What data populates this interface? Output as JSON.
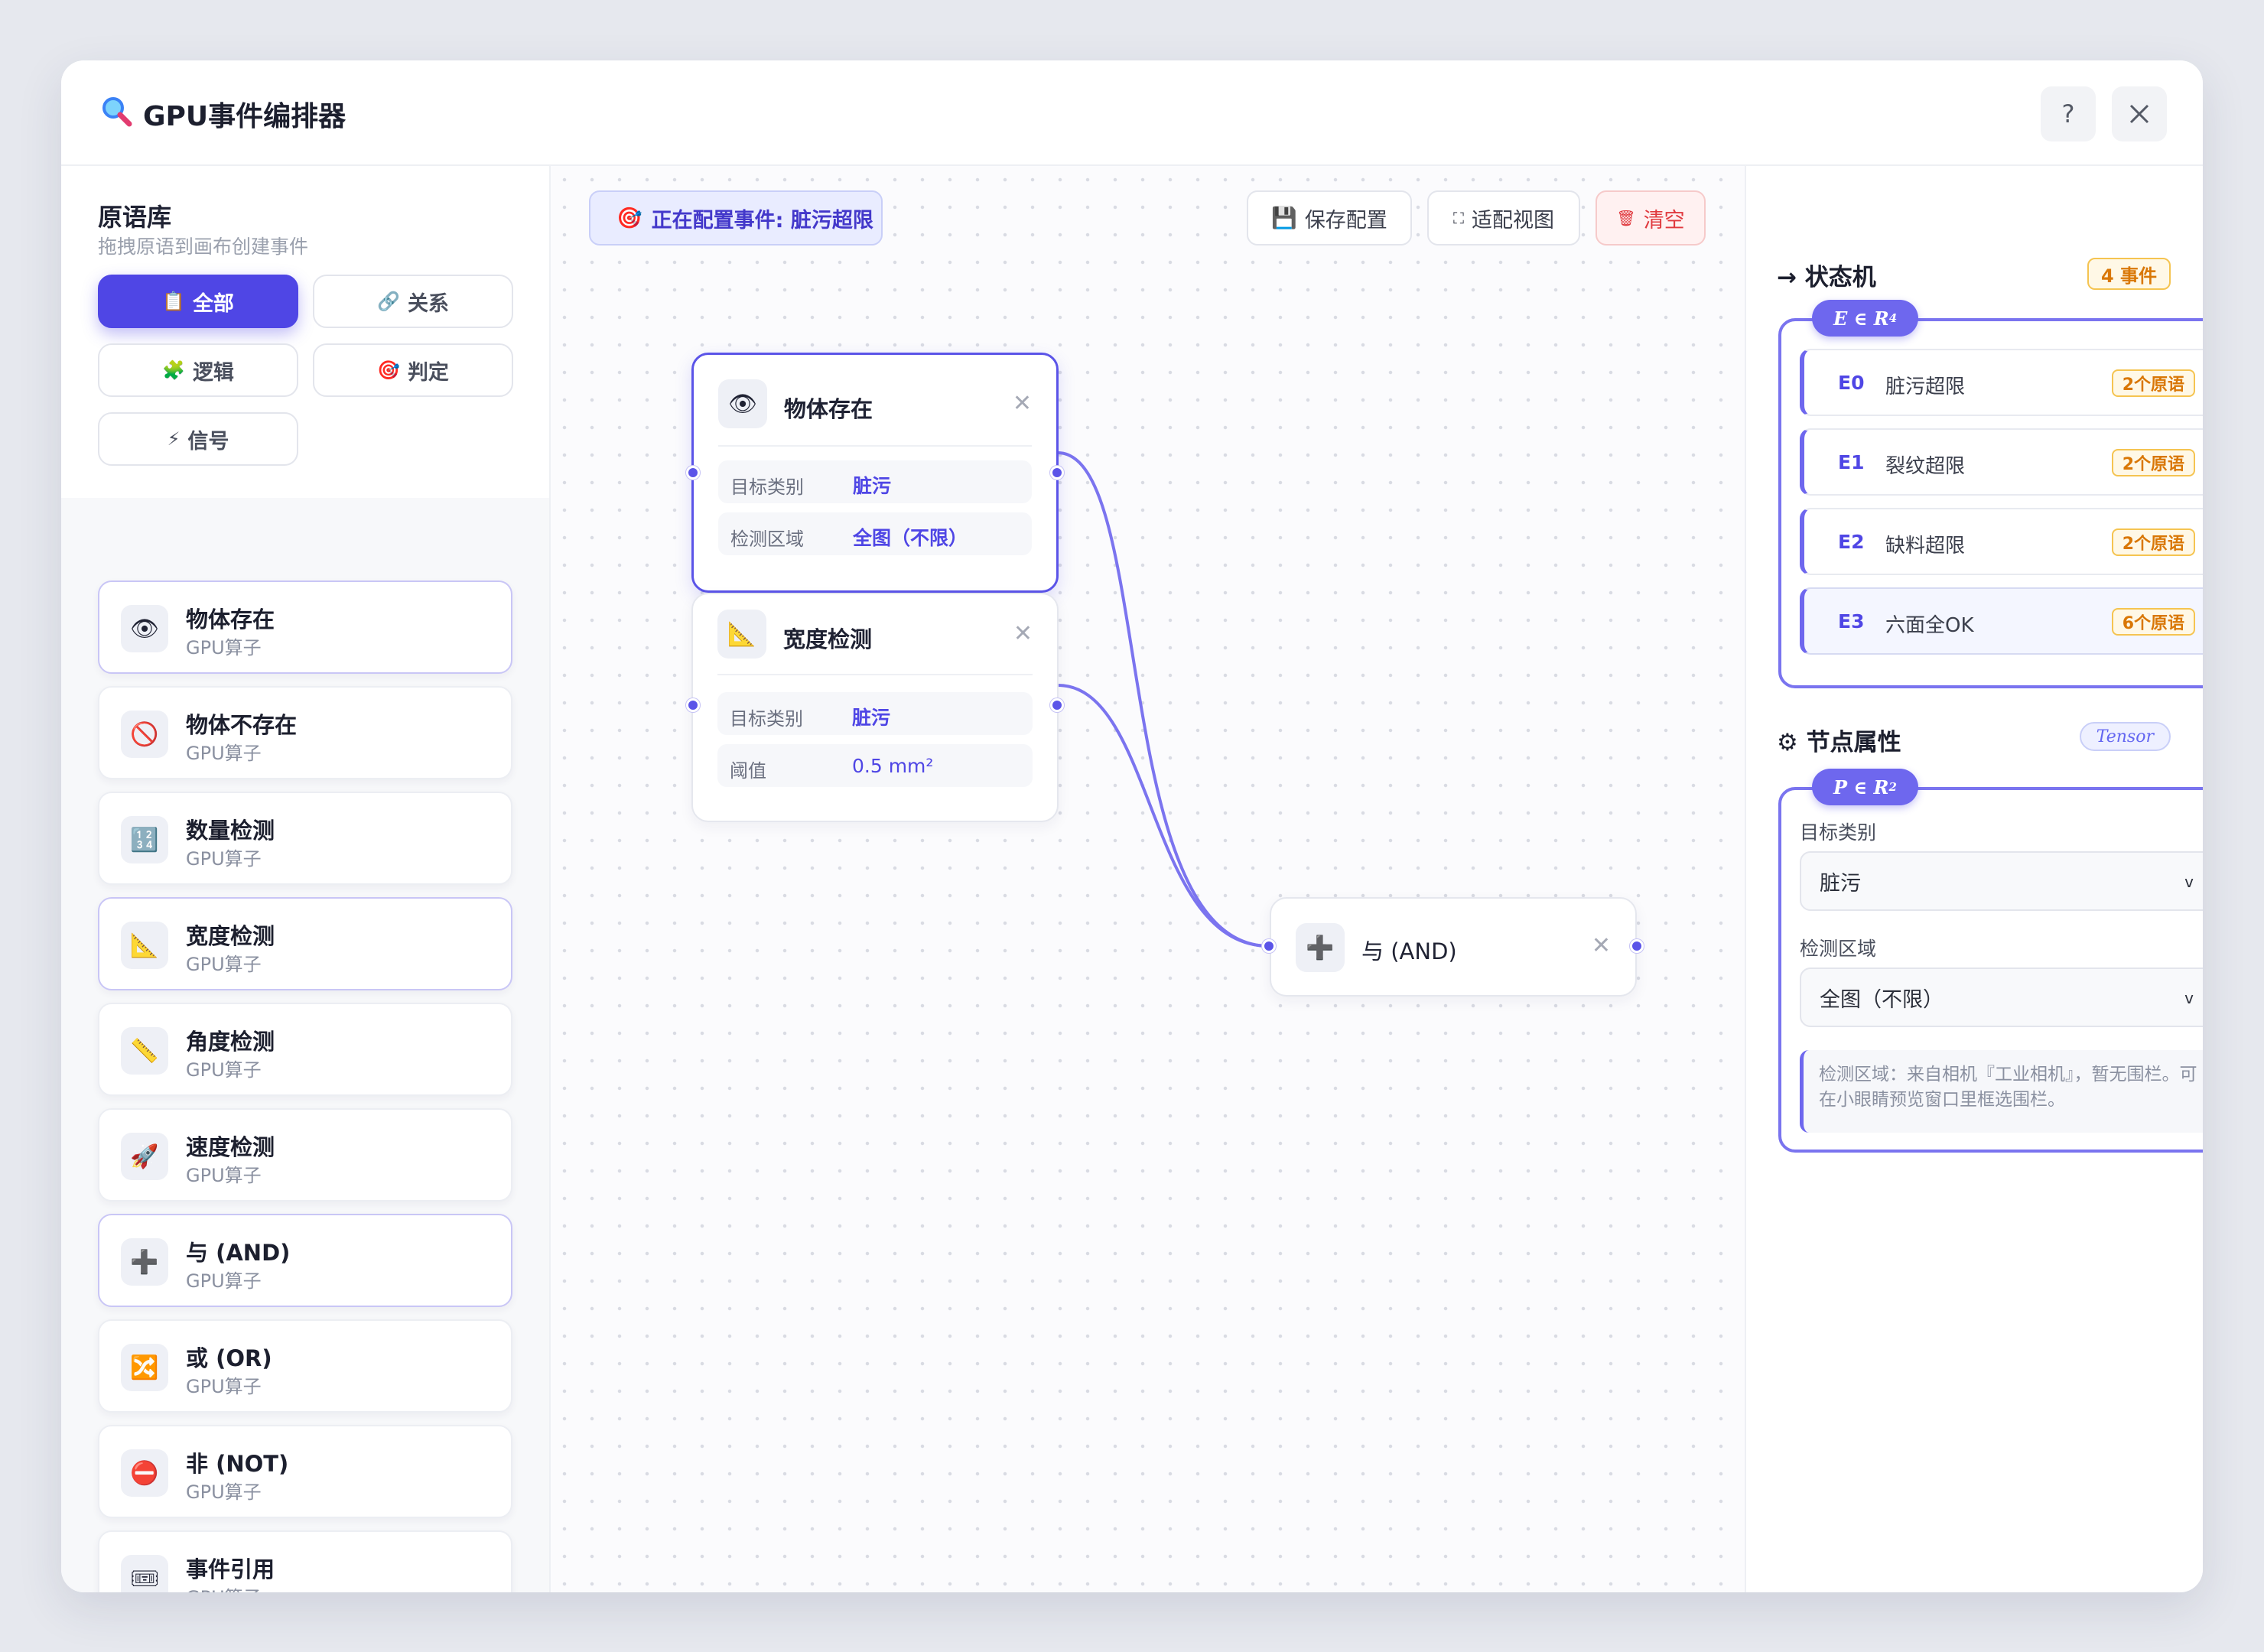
{
  "window": {
    "title": "GPU事件编排器",
    "help_label": "?",
    "close_label": "✕"
  },
  "library": {
    "title": "原语库",
    "subtitle": "拖拽原语到画布创建事件",
    "filters": [
      {
        "label": "全部",
        "icon": "📋",
        "active": true
      },
      {
        "label": "关系",
        "icon": "🔗"
      },
      {
        "label": "逻辑",
        "icon": "🧩"
      },
      {
        "label": "判定",
        "icon": "🎯"
      },
      {
        "label": "信号",
        "icon": "⚡"
      }
    ],
    "items": [
      {
        "name": "物体存在",
        "sub": "GPU算子",
        "icon": "👁"
      },
      {
        "name": "物体不存在",
        "sub": "GPU算子",
        "icon": "🚫"
      },
      {
        "name": "数量检测",
        "sub": "GPU算子",
        "icon": "🔢"
      },
      {
        "name": "宽度检测",
        "sub": "GPU算子",
        "icon": "📐"
      },
      {
        "name": "角度检测",
        "sub": "GPU算子",
        "icon": "📏"
      },
      {
        "name": "速度检测",
        "sub": "GPU算子",
        "icon": "🚀"
      },
      {
        "name": "与 (AND)",
        "sub": "GPU算子",
        "icon": "➕"
      },
      {
        "name": "或 (OR)",
        "sub": "GPU算子",
        "icon": "🔀"
      },
      {
        "name": "非 (NOT)",
        "sub": "GPU算子",
        "icon": "⛔"
      },
      {
        "name": "事件引用",
        "sub": "GPU算子",
        "icon": "🎟"
      }
    ]
  },
  "canvas": {
    "config_chip": "正在配置事件: 脏污超限",
    "config_icon": "🎯",
    "toolbar": {
      "save": "保存配置",
      "save_icon": "💾",
      "fit": "适配视图",
      "fit_icon": "⛶",
      "clear": "清空",
      "clear_icon": "🗑"
    },
    "nodes": {
      "exist": {
        "title": "物体存在",
        "icon": "👁",
        "close": "✕",
        "rows": [
          {
            "key": "目标类别",
            "value": "脏污"
          },
          {
            "key": "检测区域",
            "value": "全图（不限）"
          }
        ]
      },
      "width": {
        "title": "宽度检测",
        "icon": "📐",
        "close": "✕",
        "rows": [
          {
            "key": "目标类别",
            "value": "脏污"
          },
          {
            "key": "阈值",
            "value": "0.5 mm²"
          }
        ]
      },
      "and": {
        "title": "与 (AND)",
        "icon": "➕",
        "close": "✕"
      }
    }
  },
  "state_machine": {
    "title": "→ 状态机",
    "count_badge": "4 事件",
    "pill": {
      "base": "E ∈ R",
      "sup": "4"
    },
    "events": [
      {
        "id": "E0",
        "name": "脏污超限",
        "count": "2个原语"
      },
      {
        "id": "E1",
        "name": "裂纹超限",
        "count": "2个原语"
      },
      {
        "id": "E2",
        "name": "缺料超限",
        "count": "2个原语"
      },
      {
        "id": "E3",
        "name": "六面全OK",
        "count": "6个原语"
      }
    ]
  },
  "node_props": {
    "title": "⚙ 节点属性",
    "badge": "Tensor",
    "pill": {
      "base": "P ∈ R",
      "sup": "2"
    },
    "fields": [
      {
        "label": "目标类别",
        "value": "脏污"
      },
      {
        "label": "检测区域",
        "value": "全图（不限）"
      }
    ],
    "chevron": "v",
    "note": "检测区域：来自相机『工业相机』，暂无围栏。可在小眼睛预览窗口里框选围栏。"
  },
  "colors": {
    "accent": "#4f46e5",
    "wire": "#7b74ef",
    "warn": "#d97706",
    "danger": "#e0393e"
  }
}
